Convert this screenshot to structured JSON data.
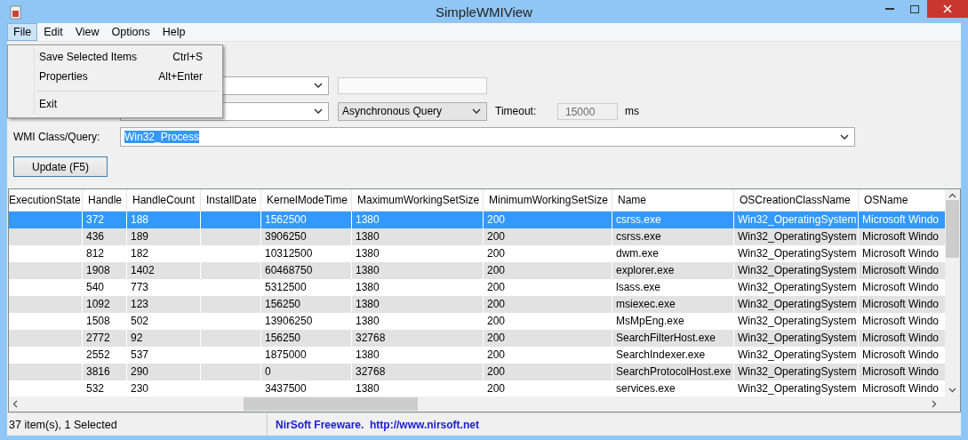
{
  "window": {
    "title": "SimpleWMIView"
  },
  "menubar": [
    {
      "label": "File",
      "selected": true
    },
    {
      "label": "Edit",
      "selected": false
    },
    {
      "label": "View",
      "selected": false
    },
    {
      "label": "Options",
      "selected": false
    },
    {
      "label": "Help",
      "selected": false
    }
  ],
  "file_menu": [
    {
      "kind": "item",
      "label": "Save Selected Items",
      "shortcut": "Ctrl+S"
    },
    {
      "kind": "item",
      "label": "Properties",
      "shortcut": "Alt+Enter"
    },
    {
      "kind": "separator"
    },
    {
      "kind": "item",
      "label": "Exit"
    }
  ],
  "form": {
    "query_mode": "Asynchronous Query",
    "timeout_label": "Timeout:",
    "timeout": "15000",
    "timeout_unit": "ms",
    "class_label": "WMI Class/Query:",
    "class_value": "Win32_Process",
    "update_button": "Update (F5)"
  },
  "table": {
    "columns": [
      "ExecutionState",
      "Handle",
      "HandleCount",
      "InstallDate",
      "KernelModeTime",
      "MaximumWorkingSetSize",
      "MinimumWorkingSetSize",
      "Name",
      "OSCreationClassName",
      "OSName"
    ],
    "rows": [
      {
        "selected": true,
        "cells": [
          "",
          "372",
          "188",
          "",
          "1562500",
          "1380",
          "200",
          "csrss.exe",
          "Win32_OperatingSystem",
          "Microsoft Windo"
        ]
      },
      {
        "selected": false,
        "cells": [
          "",
          "436",
          "189",
          "",
          "3906250",
          "1380",
          "200",
          "csrss.exe",
          "Win32_OperatingSystem",
          "Microsoft Windo"
        ]
      },
      {
        "selected": false,
        "cells": [
          "",
          "812",
          "182",
          "",
          "10312500",
          "1380",
          "200",
          "dwm.exe",
          "Win32_OperatingSystem",
          "Microsoft Windo"
        ]
      },
      {
        "selected": false,
        "cells": [
          "",
          "1908",
          "1402",
          "",
          "60468750",
          "1380",
          "200",
          "explorer.exe",
          "Win32_OperatingSystem",
          "Microsoft Windo"
        ]
      },
      {
        "selected": false,
        "cells": [
          "",
          "540",
          "773",
          "",
          "5312500",
          "1380",
          "200",
          "lsass.exe",
          "Win32_OperatingSystem",
          "Microsoft Windo"
        ]
      },
      {
        "selected": false,
        "cells": [
          "",
          "1092",
          "123",
          "",
          "156250",
          "1380",
          "200",
          "msiexec.exe",
          "Win32_OperatingSystem",
          "Microsoft Windo"
        ]
      },
      {
        "selected": false,
        "cells": [
          "",
          "1508",
          "502",
          "",
          "13906250",
          "1380",
          "200",
          "MsMpEng.exe",
          "Win32_OperatingSystem",
          "Microsoft Windo"
        ]
      },
      {
        "selected": false,
        "cells": [
          "",
          "2772",
          "92",
          "",
          "156250",
          "32768",
          "200",
          "SearchFilterHost.exe",
          "Win32_OperatingSystem",
          "Microsoft Windo"
        ]
      },
      {
        "selected": false,
        "cells": [
          "",
          "2552",
          "537",
          "",
          "1875000",
          "1380",
          "200",
          "SearchIndexer.exe",
          "Win32_OperatingSystem",
          "Microsoft Windo"
        ]
      },
      {
        "selected": false,
        "cells": [
          "",
          "3816",
          "290",
          "",
          "0",
          "32768",
          "200",
          "SearchProtocolHost.exe",
          "Win32_OperatingSystem",
          "Microsoft Windo"
        ]
      },
      {
        "selected": false,
        "cells": [
          "",
          "532",
          "230",
          "",
          "3437500",
          "1380",
          "200",
          "services.exe",
          "Win32_OperatingSystem",
          "Microsoft Windo"
        ]
      }
    ]
  },
  "status_bar": {
    "count": "37 item(s), 1 Selected",
    "credit": "NirSoft Freeware.  http://www.nirsoft.net"
  }
}
